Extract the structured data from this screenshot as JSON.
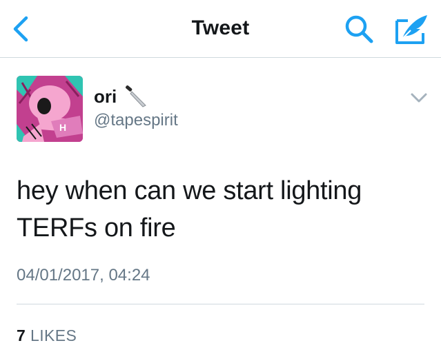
{
  "nav": {
    "title": "Tweet",
    "back_icon": "chevron-left-icon",
    "search_icon": "search-icon",
    "compose_icon": "compose-feather-icon",
    "accent_color": "#1da1f2"
  },
  "tweet": {
    "author": {
      "name": "ori",
      "emoji": "knife-emoji",
      "handle": "@tapespirit",
      "avatar": "avatar-pink-illustration"
    },
    "text": "hey when can we start lighting TERFs on fire",
    "timestamp": "04/01/2017, 04:24",
    "likes": {
      "count": "7",
      "label": "LIKES"
    }
  }
}
